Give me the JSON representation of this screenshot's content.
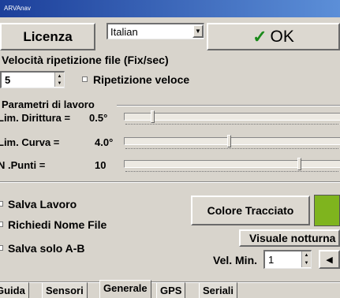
{
  "window": {
    "title": "ARVAnav"
  },
  "toolbar": {
    "license_label": "Licenza",
    "language_value": "Italian",
    "ok_label": "OK",
    "ok_icon": "checkmark-icon",
    "ok_icon_color": "#1a8a1a"
  },
  "speed": {
    "label": "Velocità ripetizione file (Fix/sec)",
    "value": "5",
    "fast_repeat_label": "Ripetizione veloce",
    "fast_repeat_checked": false
  },
  "params": {
    "header": "Parametri di lavoro",
    "rows": [
      {
        "label": "Lim. Dirittura =",
        "value": "0.5°",
        "level": 0.13
      },
      {
        "label": "Lim. Curva =",
        "value": "4.0°",
        "level": 0.5
      },
      {
        "label": "N .Punti =",
        "value": "10",
        "level": 0.84
      }
    ]
  },
  "options": {
    "save_work": "Salva Lavoro",
    "ask_filename": "Richiedi  Nome File",
    "save_ab": "Salva solo A-B"
  },
  "track_color": {
    "label": "Colore Tracciato",
    "swatch": "#7fb41e"
  },
  "night_view": {
    "label": "Visuale notturna"
  },
  "min_speed": {
    "label": "Vel. Min.",
    "value": "1"
  },
  "tabs": [
    {
      "label": "Guida",
      "active": false
    },
    {
      "label": "Sensori",
      "active": false
    },
    {
      "label": "Generale",
      "active": true
    },
    {
      "label": "GPS",
      "active": false
    },
    {
      "label": "Seriali",
      "active": false
    }
  ]
}
